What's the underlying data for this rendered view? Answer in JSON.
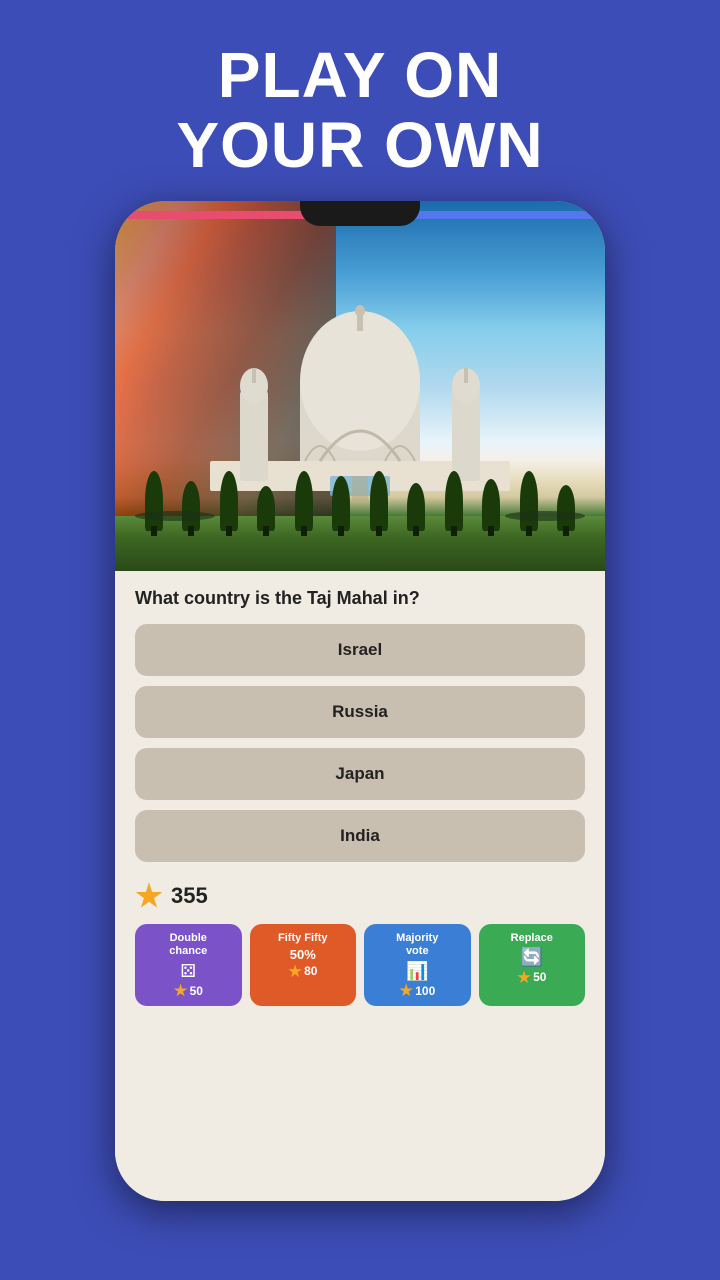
{
  "header": {
    "line1": "PLAY ON",
    "line2": "YOUR OWN"
  },
  "quiz": {
    "question": "What country is the Taj Mahal in?",
    "answers": [
      "Israel",
      "Russia",
      "Japan",
      "India"
    ],
    "score": "355"
  },
  "powerups": [
    {
      "id": "double-chance",
      "label": "Double chance",
      "icon": "⚄",
      "cost": "50",
      "color": "purple"
    },
    {
      "id": "fifty-fifty",
      "label": "Fifty Fifty",
      "icon": "50%",
      "cost": "80",
      "color": "orange"
    },
    {
      "id": "majority-vote",
      "label": "Majority vote",
      "icon": "📊",
      "cost": "100",
      "color": "blue"
    },
    {
      "id": "replace",
      "label": "Replace",
      "icon": "🔄",
      "cost": "50",
      "color": "green"
    }
  ]
}
